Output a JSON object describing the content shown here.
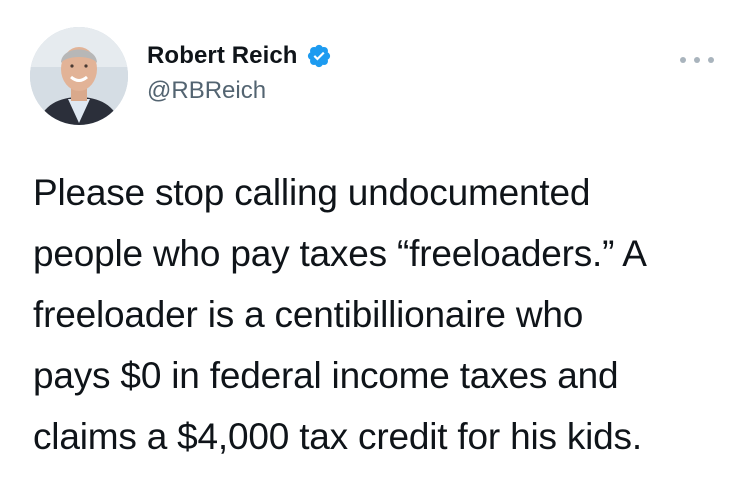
{
  "tweet": {
    "author": {
      "display_name": "Robert Reich",
      "handle": "@RBReich",
      "verified": true
    },
    "more_icon": "more-horizontal-icon",
    "text_lines": [
      "Please stop calling undocumented",
      "people who pay taxes “freeloaders.” A",
      "freeloader is a centibillionaire who",
      "pays $0 in federal income taxes and",
      "claims a $4,000 tax credit for his kids."
    ]
  },
  "colors": {
    "text": "#0f1419",
    "secondary_text": "#536471",
    "verified_blue": "#1d9bf0",
    "more_dots": "#a9b4bd",
    "background": "#ffffff"
  }
}
